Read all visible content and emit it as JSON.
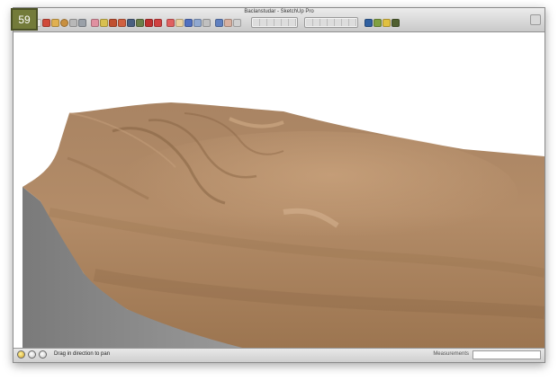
{
  "page_badge": {
    "number": "59",
    "color": "#737b3a"
  },
  "window": {
    "title": "Baclanstudar - SketchUp Pro"
  },
  "toolbar": {
    "icons": [
      "select-icon",
      "pencil-icon",
      "rectangle-icon",
      "circle-icon",
      "arc-icon",
      "polygon-icon",
      "eraser-icon",
      "paint-bucket-icon",
      "push-pull-icon",
      "move-icon",
      "rotate-icon",
      "scale-icon",
      "follow-me-icon",
      "offset-icon",
      "tape-measure-icon",
      "dimension-icon",
      "protractor-icon",
      "text-icon",
      "axes-icon",
      "orbit-icon",
      "pan-icon",
      "zoom-icon",
      "zoom-window-icon",
      "zoom-extents-icon",
      "standard-views-icon",
      "styles-icon",
      "shadows-icon",
      "components-icon",
      "section-plane-icon",
      "layers-icon"
    ]
  },
  "viewport": {
    "terrain_color": "#b08965",
    "terrain_shadow_color": "#8c6844",
    "side_face_color": "#8a8a8a"
  },
  "status_bar": {
    "icons": [
      "geo-location-icon",
      "credits-icon",
      "help-icon"
    ],
    "message": "Drag in direction to pan",
    "measurements_label": "Measurements",
    "measurements_value": ""
  }
}
